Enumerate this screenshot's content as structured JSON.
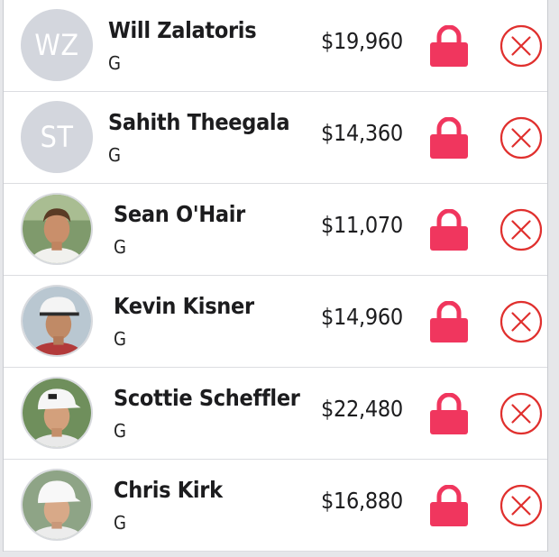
{
  "colors": {
    "lock": "#f0365e",
    "remove": "#e0302e",
    "initials_bg": "#d3d6dd"
  },
  "players": [
    {
      "name": "Will Zalatoris",
      "position": "G",
      "salary": "$19,960",
      "avatar": {
        "type": "initials",
        "text": "WZ"
      },
      "lock_icon": "lock-icon",
      "remove_icon": "close-circle-icon"
    },
    {
      "name": "Sahith Theegala",
      "position": "G",
      "salary": "$14,360",
      "avatar": {
        "type": "initials",
        "text": "ST"
      },
      "lock_icon": "lock-icon",
      "remove_icon": "close-circle-icon"
    },
    {
      "name": "Sean O'Hair",
      "position": "G",
      "salary": "$11,070",
      "avatar": {
        "type": "photo",
        "hat": "none"
      },
      "lock_icon": "lock-icon",
      "remove_icon": "close-circle-icon"
    },
    {
      "name": "Kevin Kisner",
      "position": "G",
      "salary": "$14,960",
      "avatar": {
        "type": "photo",
        "hat": "white"
      },
      "lock_icon": "lock-icon",
      "remove_icon": "close-circle-icon"
    },
    {
      "name": "Scottie Scheffler",
      "position": "G",
      "salary": "$22,480",
      "avatar": {
        "type": "photo",
        "hat": "white"
      },
      "lock_icon": "lock-icon",
      "remove_icon": "close-circle-icon"
    },
    {
      "name": "Chris Kirk",
      "position": "G",
      "salary": "$16,880",
      "avatar": {
        "type": "photo",
        "hat": "white"
      },
      "lock_icon": "lock-icon",
      "remove_icon": "close-circle-icon"
    }
  ]
}
